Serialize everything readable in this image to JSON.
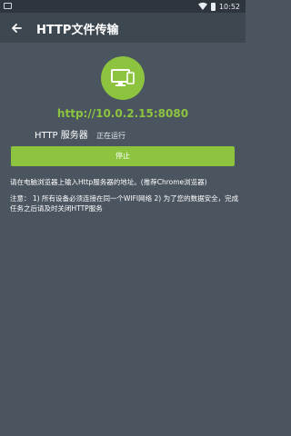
{
  "status_bar": {
    "time": "10:52",
    "wifi_icon": "wifi-icon",
    "battery_icon": "battery-icon"
  },
  "app_bar": {
    "title": "HTTP文件传输",
    "back_icon": "back-arrow-icon"
  },
  "server": {
    "url": "http://10.0.2.15:8080",
    "label": "HTTP 服务器",
    "status": "正在运行"
  },
  "stop_button": {
    "label": "停止"
  },
  "tip_text": "请在电脑浏览器上输入Http服务器的地址。(推荐Chrome浏览器)",
  "note_text": "注意： 1) 所有设备必须连接在同一个WIFI网络 2) 为了您的数据安全，完成任务之后请及时关闭HTTP服务",
  "colors": {
    "accent": "#8cc43f",
    "background": "#4b555f",
    "appbar": "#3d474f"
  }
}
